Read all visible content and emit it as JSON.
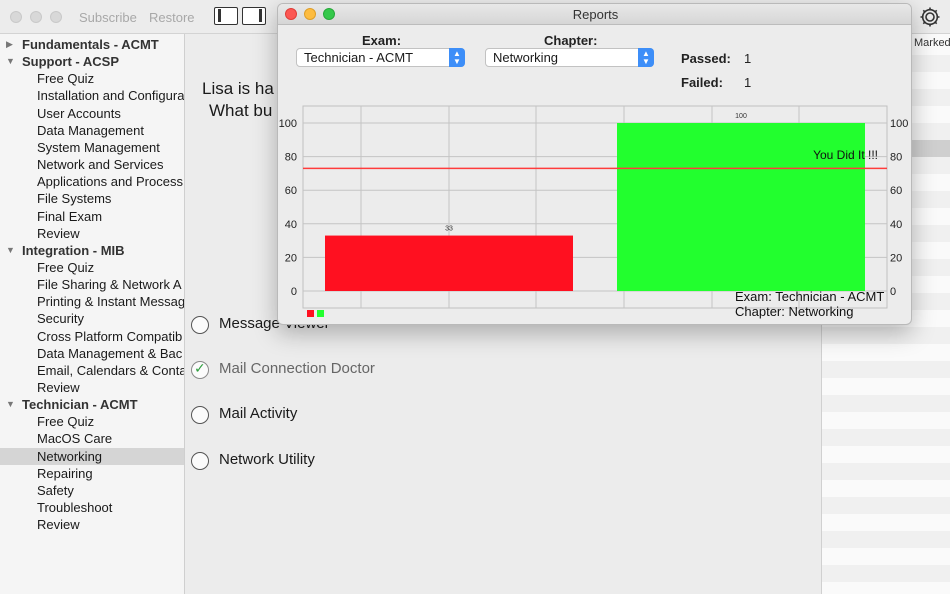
{
  "toolbar": {
    "subscribe_label": "Subscribe",
    "restore_label": "Restore",
    "settings_icon": "gear-icon"
  },
  "sidebar": {
    "groups": [
      {
        "label": "Fundamentals - ACMT",
        "expanded": false,
        "items": []
      },
      {
        "label": "Support - ACSP",
        "expanded": true,
        "items": [
          "Free Quiz",
          "Installation and Configura",
          "User Accounts",
          "Data Management",
          "System Management",
          "Network and Services",
          "Applications and Process",
          "File Systems",
          "Final Exam",
          "Review"
        ]
      },
      {
        "label": "Integration - MIB",
        "expanded": true,
        "items": [
          "Free Quiz",
          "File Sharing & Network A",
          "Printing & Instant Messag",
          "Security",
          "Cross Platform Compatib",
          "Data Management & Bac",
          "Email, Calendars & Conta",
          "Review"
        ]
      },
      {
        "label": "Technician - ACMT",
        "expanded": true,
        "items": [
          "Free Quiz",
          "MacOS Care",
          "Networking",
          "Repairing",
          "Safety",
          "Troubleshoot",
          "Review"
        ]
      }
    ],
    "selected": "Networking"
  },
  "question": {
    "line1": "Lisa is ha",
    "line2": "What bu"
  },
  "options": [
    {
      "label": "Message Viewer",
      "checked": false
    },
    {
      "label": "Mail Connection Doctor",
      "checked": true
    },
    {
      "label": "Mail Activity",
      "checked": false
    },
    {
      "label": "Network Utility",
      "checked": false
    }
  ],
  "right_panel": {
    "header": "Marked"
  },
  "reports": {
    "title": "Reports",
    "exam_label": "Exam:",
    "exam_value": "Technician - ACMT",
    "chapter_label": "Chapter:",
    "chapter_value": "Networking",
    "passed_label": "Passed:",
    "passed_value": "1",
    "failed_label": "Failed:",
    "failed_value": "1",
    "footer_exam": "Exam: Technician - ACMT",
    "footer_chapter": "Chapter: Networking"
  },
  "chart_data": {
    "type": "bar",
    "values": [
      33,
      100
    ],
    "value_labels": [
      "33",
      "100"
    ],
    "colors": [
      "#ff1020",
      "#22ff2e"
    ],
    "ylim": [
      0,
      100
    ],
    "yticks": [
      "0",
      "20",
      "40",
      "60",
      "80",
      "100"
    ],
    "threshold": 73,
    "threshold_color": "#ff3b3b",
    "annotation": "You Did It !!!",
    "grid": true,
    "right_axis": true,
    "legend_swatches": [
      "#ff1020",
      "#22ff2e"
    ]
  }
}
